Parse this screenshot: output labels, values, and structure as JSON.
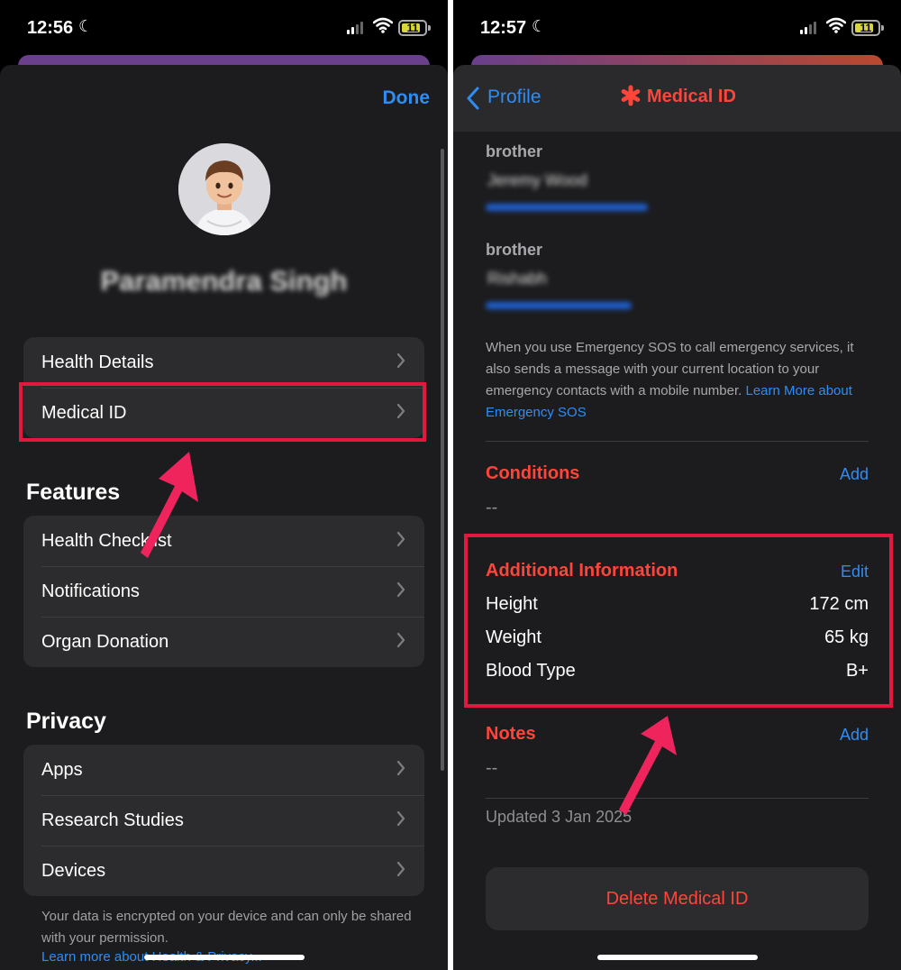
{
  "left": {
    "status": {
      "time": "12:56",
      "battery": "11"
    },
    "nav": {
      "done_label": "Done"
    },
    "profile": {
      "name": "Paramendra Singh"
    },
    "group1": [
      {
        "label": "Health Details"
      },
      {
        "label": "Medical ID"
      }
    ],
    "features": {
      "title": "Features",
      "items": [
        {
          "label": "Health Checklist"
        },
        {
          "label": "Notifications"
        },
        {
          "label": "Organ Donation"
        }
      ]
    },
    "privacy": {
      "title": "Privacy",
      "items": [
        {
          "label": "Apps"
        },
        {
          "label": "Research Studies"
        },
        {
          "label": "Devices"
        }
      ],
      "footnote": "Your data is encrypted on your device and can only be shared with your permission.",
      "link": "Learn more about Health & Privacy..."
    }
  },
  "right": {
    "status": {
      "time": "12:57",
      "battery": "11"
    },
    "nav": {
      "back_label": "Profile",
      "title": "Medical ID"
    },
    "contacts": [
      {
        "relation": "brother",
        "name": "Jeremy Wood"
      },
      {
        "relation": "brother",
        "name": "Rishabh"
      }
    ],
    "sos": {
      "text": "When you use Emergency SOS to call emergency services, it also sends a message with your current location to your emergency contacts with a mobile number. ",
      "link": "Learn More about Emergency SOS"
    },
    "conditions": {
      "title": "Conditions",
      "action": "Add",
      "value": "--"
    },
    "additional": {
      "title": "Additional Information",
      "action": "Edit",
      "rows": [
        {
          "label": "Height",
          "value": "172 cm"
        },
        {
          "label": "Weight",
          "value": "65 kg"
        },
        {
          "label": "Blood Type",
          "value": "B+"
        }
      ]
    },
    "notes": {
      "title": "Notes",
      "action": "Add",
      "value": "--"
    },
    "updated": "Updated 3 Jan 2025",
    "delete_label": "Delete Medical ID"
  },
  "colors": {
    "accent_blue": "#2e8df5",
    "destructive_red": "#ff453a",
    "highlight_red": "#e3173f",
    "arrow_pink": "#f0245c"
  }
}
